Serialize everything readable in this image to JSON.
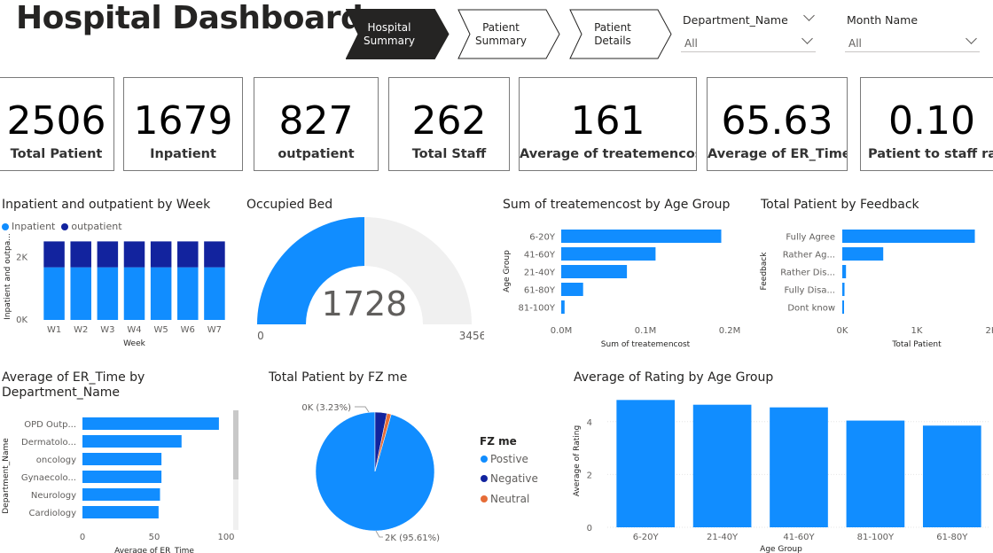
{
  "header": {
    "title": "Hospital Dashboard"
  },
  "nav": [
    {
      "line1": "Hospital",
      "line2": "Summary",
      "active": true
    },
    {
      "line1": "Patient",
      "line2": "Summary",
      "active": false
    },
    {
      "line1": "Patient",
      "line2": "Details",
      "active": false
    }
  ],
  "slicers": [
    {
      "title": "Department_Name",
      "value": "All"
    },
    {
      "title": "Month Name",
      "value": "All"
    }
  ],
  "kpis": [
    {
      "value": "2506",
      "label": "Total Patient"
    },
    {
      "value": "1679",
      "label": "Inpatient"
    },
    {
      "value": "827",
      "label": "outpatient"
    },
    {
      "value": "262",
      "label": "Total Staff"
    },
    {
      "value": "161",
      "label": "Average of treatemencost"
    },
    {
      "value": "65.63",
      "label": "Average of ER_Time"
    },
    {
      "value": "0.10",
      "label": "Patient to staff ratio"
    }
  ],
  "colors": {
    "primary": "#118dff",
    "secondary": "#12239e",
    "tertiary": "#e66c37",
    "gauge_bg": "#f0f0f0"
  },
  "chart_data": [
    {
      "type": "bar",
      "stacked": true,
      "title": "Inpatient and outpatient by Week",
      "xlabel": "Week",
      "ylabel": "Inpatient and outpa...",
      "categories": [
        "W1",
        "W2",
        "W3",
        "W4",
        "W5",
        "W6",
        "W7"
      ],
      "series": [
        {
          "name": "Inpatient",
          "values": [
            1679,
            1679,
            1679,
            1679,
            1679,
            1679,
            1679
          ]
        },
        {
          "name": "outpatient",
          "values": [
            827,
            827,
            827,
            827,
            827,
            827,
            827
          ]
        }
      ],
      "yticks": [
        "0K",
        "2K"
      ],
      "ylim": [
        0,
        2800
      ],
      "legend_position": "top-left"
    },
    {
      "type": "gauge",
      "title": "Occupied Bed",
      "value": 1728,
      "value_label": "1728",
      "min": 0,
      "max": 3456,
      "min_label": "0",
      "max_label": "3456"
    },
    {
      "type": "bar",
      "orientation": "horizontal",
      "title": "Sum of treatemencost by Age Group",
      "xlabel": "Sum of treatemencost",
      "ylabel": "Age Group",
      "categories": [
        "6-20Y",
        "41-60Y",
        "21-40Y",
        "61-80Y",
        "81-100Y"
      ],
      "values": [
        190000,
        112000,
        78000,
        26000,
        4000
      ],
      "xticks": [
        "0.0M",
        "0.1M",
        "0.2M"
      ],
      "xlim": [
        0,
        200000
      ]
    },
    {
      "type": "bar",
      "orientation": "horizontal",
      "title": "Total Patient by Feedback",
      "xlabel": "Total Patient",
      "ylabel": "Feedback",
      "categories": [
        "Fully Agree",
        "Rather Ag...",
        "Rather Dis...",
        "Fully Disa...",
        "Dont know"
      ],
      "values": [
        1780,
        550,
        50,
        30,
        20
      ],
      "xticks": [
        "0K",
        "1K",
        "2K"
      ],
      "xlim": [
        0,
        2000
      ]
    },
    {
      "type": "bar",
      "orientation": "horizontal",
      "title": "Average of ER_Time by Department_Name",
      "xlabel": "Average of ER_Time",
      "ylabel": "Department_Name",
      "categories": [
        "OPD Outp...",
        "Dermatolo...",
        "oncology",
        "Gynaecolo...",
        "Neurology",
        "Cardiology"
      ],
      "values": [
        95,
        69,
        55,
        55,
        54,
        53
      ],
      "xticks": [
        "0",
        "50",
        "100"
      ],
      "xlim": [
        0,
        100
      ]
    },
    {
      "type": "pie",
      "title": "Total Patient by FZ me",
      "legend_title": "FZ me",
      "slices": [
        {
          "name": "Postive",
          "value": 95.61,
          "label": "2K (95.61%)"
        },
        {
          "name": "Negative",
          "value": 3.23,
          "label": "0K (3.23%)"
        },
        {
          "name": "Neutral",
          "value": 1.16,
          "label": ""
        }
      ]
    },
    {
      "type": "bar",
      "title": "Average of Rating by Age Group",
      "xlabel": "Age Group",
      "ylabel": "Average of Rating",
      "categories": [
        "6-20Y",
        "21-40Y",
        "41-60Y",
        "81-100Y",
        "61-80Y"
      ],
      "values": [
        4.82,
        4.64,
        4.54,
        4.04,
        3.85
      ],
      "yticks": [
        "0",
        "2",
        "4"
      ],
      "ylim": [
        0,
        5.2
      ]
    }
  ]
}
